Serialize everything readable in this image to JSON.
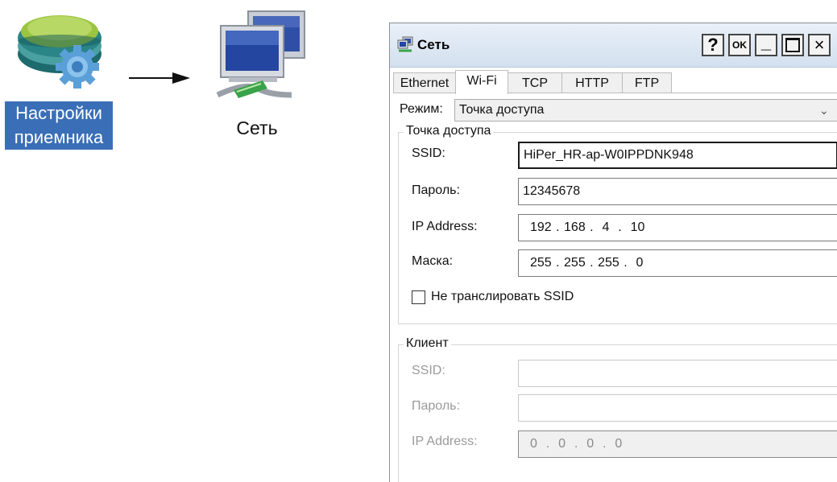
{
  "illustration": {
    "receiver_label_line1": "Настройки",
    "receiver_label_line2": "приемника",
    "network_label": "Сеть"
  },
  "dialog": {
    "title": "Сеть",
    "buttons": {
      "help": "?",
      "ok": "OK",
      "minimize": "_",
      "close": "×"
    },
    "tabs": [
      {
        "label": "Ethernet",
        "active": false
      },
      {
        "label": "Wi-Fi",
        "active": true
      },
      {
        "label": "TCP",
        "active": false
      },
      {
        "label": "HTTP",
        "active": false
      },
      {
        "label": "FTP",
        "active": false
      }
    ],
    "mode": {
      "label": "Режим:",
      "value": "Точка доступа"
    },
    "access_point": {
      "title": "Точка доступа",
      "ssid_label": "SSID:",
      "ssid_value": "HiPer_HR-ap-W0IPPDNK948",
      "password_label": "Пароль:",
      "password_value": "12345678",
      "ip_label": "IP Address:",
      "ip_value": "192 . 168 .  4  .  10",
      "mask_label": "Маска:",
      "mask_value": "255 . 255 . 255 .  0",
      "hide_ssid_label": "Не транслировать SSID",
      "hide_ssid_checked": false
    },
    "client": {
      "title": "Клиент",
      "ssid_label": "SSID:",
      "ssid_value": "",
      "password_label": "Пароль:",
      "password_value": "",
      "ip_label": "IP Address:",
      "ip_value": "0  .  0  .  0  .  0"
    }
  },
  "colors": {
    "label_highlight": "#3a6fb7",
    "titlebar_top": "#e9f0f8",
    "titlebar_bottom": "#d3e0ef"
  }
}
